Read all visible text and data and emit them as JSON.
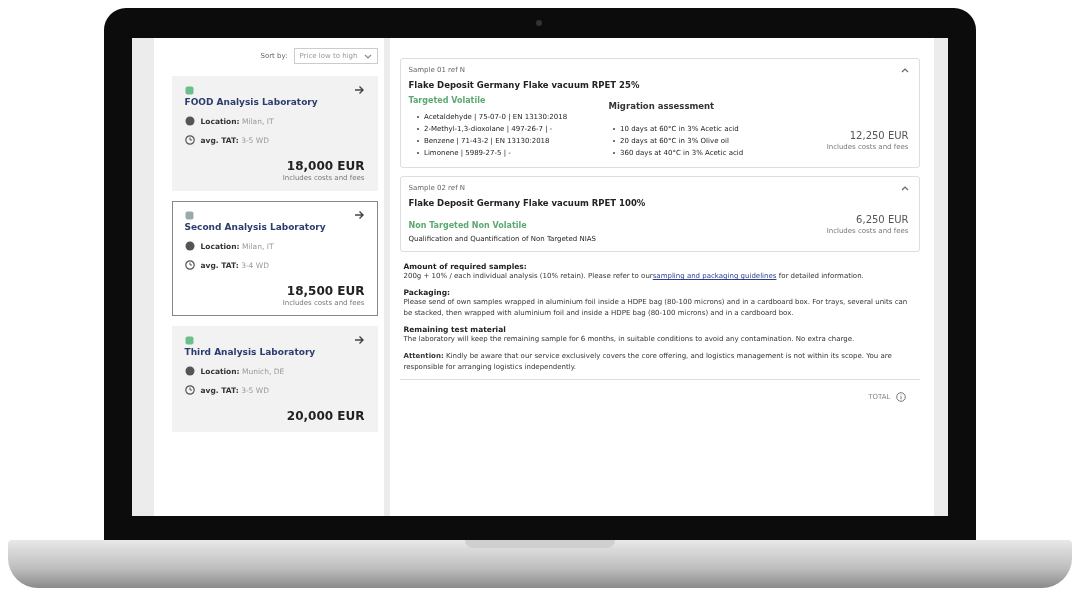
{
  "sort": {
    "label": "Sort by:",
    "value": "Price low to high"
  },
  "labs": [
    {
      "name": "FOOD Analysis Laboratory",
      "location_label": "Location:",
      "location": "Milan, IT",
      "tat_label": "avg. TAT:",
      "tat": "3-5 WD",
      "price": "18,000 EUR",
      "price_note": "Includes costs and fees",
      "selected": false
    },
    {
      "name": "Second Analysis Laboratory",
      "location_label": "Location:",
      "location": "Milan, IT",
      "tat_label": "avg. TAT:",
      "tat": "3-4 WD",
      "price": "18,500 EUR",
      "price_note": "Includes costs and fees",
      "selected": true
    },
    {
      "name": "Third Analysis Laboratory",
      "location_label": "Location:",
      "location": "Munich, DE",
      "tat_label": "avg. TAT:",
      "tat": "3-5 WD",
      "price": "20,000 EUR",
      "selected": false
    }
  ],
  "samples": [
    {
      "kind": "targeted",
      "ref": "Sample 01 ref N",
      "title": "Flake Deposit Germany Flake vacuum RPET 25%",
      "method": "Targeted Volatile",
      "expanded": true,
      "analytes": [
        "Acetaldehyde  |  75-07-0  |  EN 13130:2018",
        "2-Methyl-1,3-dioxolane  |  497-26-7  |  -",
        "Benzene  |  71-43-2  |  EN 13130:2018",
        "Limonene  |  5989-27-5  |  -"
      ],
      "migration_title": "Migration assessment",
      "migration": [
        "10 days at 60°C in 3% Acetic acid",
        "20 days at 60°C in 3% Olive oil",
        "360 days at 40°C in 3% Acetic acid"
      ],
      "price": "12,250 EUR",
      "price_note": "Includes costs and fees"
    },
    {
      "kind": "nontargeted",
      "ref": "Sample 02 ref N",
      "title": "Flake Deposit Germany Flake vacuum RPET 100%",
      "method": "Non Targeted Non Volatile",
      "expanded": true,
      "description": "Qualification and Quantification of Non Targeted NIAS",
      "price": "6,250 EUR",
      "price_note": "Includes costs and fees"
    }
  ],
  "info": [
    {
      "kind": "block",
      "heading": "Amount of required samples:",
      "text": "200g + 10% / each individual analysis (10% retain). Please refer to our",
      "link": "sampling and packaging guidelines",
      "text_after": "for detailed information."
    },
    {
      "kind": "block",
      "heading": "Packaging:",
      "text": "Please send of own samples wrapped in aluminium foil inside a HDPE bag (80-100 microns) and in a cardboard box. For trays, several units can be stacked, then wrapped with aluminium foil and inside a HDPE bag (80-100 microns) and in a cardboard box."
    },
    {
      "kind": "block",
      "heading": "Remaining test material",
      "text": "The laboratory will keep the remaining sample for 6 months, in suitable conditions to avoid any contamination. No extra charge."
    },
    {
      "kind": "inline",
      "text": "**Attention:** Kindly be aware that our service exclusively covers the core offering, and logistics management is not within its scope. You are responsible for arranging logistics independently."
    }
  ],
  "footer": {
    "label": "TOTAL"
  }
}
